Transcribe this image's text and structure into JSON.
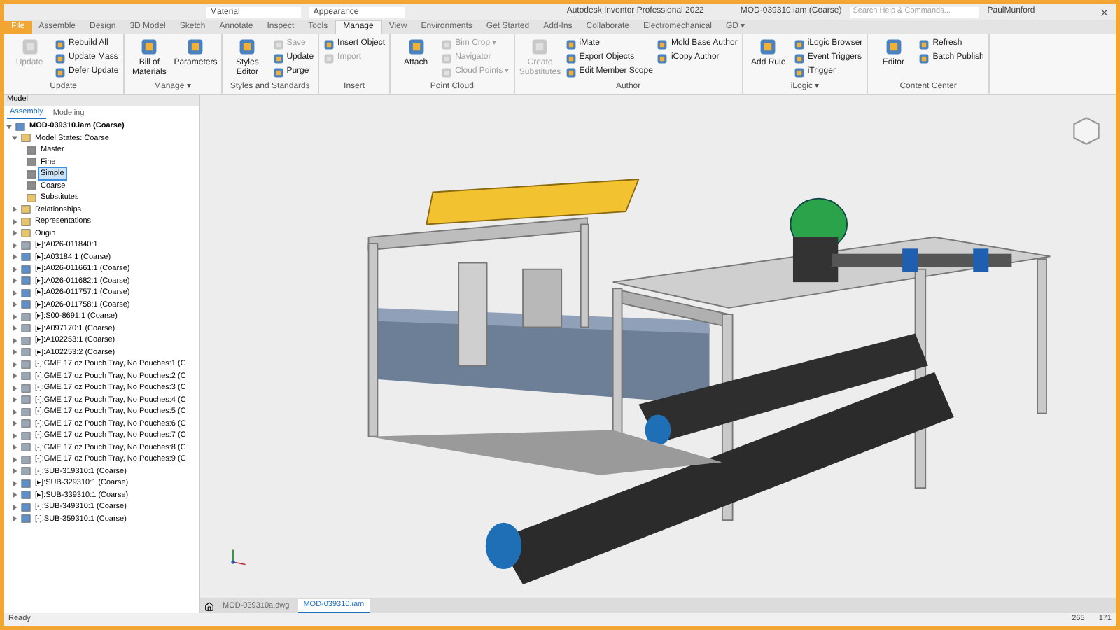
{
  "title_bar": {
    "app_title": "Autodesk Inventor Professional 2022",
    "document": "MOD-039310.iam (Coarse)",
    "material": "Material",
    "appearance": "Appearance",
    "search": {
      "placeholder": "Search Help & Commands..."
    },
    "user": "PaulMunford"
  },
  "ribbon_tabs": [
    {
      "label": "File",
      "selected": false,
      "kind": "file"
    },
    {
      "label": "Assemble",
      "selected": false
    },
    {
      "label": "Design",
      "selected": false
    },
    {
      "label": "3D Model",
      "selected": false
    },
    {
      "label": "Sketch",
      "selected": false
    },
    {
      "label": "Annotate",
      "selected": false
    },
    {
      "label": "Inspect",
      "selected": false
    },
    {
      "label": "Tools",
      "selected": false
    },
    {
      "label": "Manage",
      "selected": true
    },
    {
      "label": "View",
      "selected": false
    },
    {
      "label": "Environments",
      "selected": false
    },
    {
      "label": "Get Started",
      "selected": false
    },
    {
      "label": "Add-Ins",
      "selected": false
    },
    {
      "label": "Collaborate",
      "selected": false
    },
    {
      "label": "Electromechanical",
      "selected": false
    },
    {
      "label": "GD ▾",
      "selected": false
    }
  ],
  "ribbon_groups": [
    {
      "label": "Update",
      "items": [
        {
          "label": "Update",
          "kind": "big",
          "disabled": true
        },
        {
          "label": "Rebuild All",
          "kind": "small",
          "disabled": false
        },
        {
          "label": "Update Mass",
          "kind": "small",
          "disabled": false
        },
        {
          "label": "Defer Update",
          "kind": "small",
          "disabled": false
        }
      ]
    },
    {
      "label": "Manage ▾",
      "items": [
        {
          "label": "Bill of Materials",
          "kind": "big",
          "disabled": false
        },
        {
          "label": "Parameters",
          "kind": "big",
          "disabled": false
        }
      ]
    },
    {
      "label": "Styles and Standards",
      "items": [
        {
          "label": "Styles Editor",
          "kind": "big",
          "disabled": false
        },
        {
          "label": "Save",
          "kind": "small",
          "disabled": true
        },
        {
          "label": "Update",
          "kind": "small",
          "disabled": false
        },
        {
          "label": "Purge",
          "kind": "small",
          "disabled": false
        }
      ]
    },
    {
      "label": "Insert",
      "items": [
        {
          "label": "Insert Object",
          "kind": "small",
          "disabled": false
        },
        {
          "label": "Import",
          "kind": "small",
          "disabled": true
        }
      ]
    },
    {
      "label": "Point Cloud",
      "items": [
        {
          "label": "Attach",
          "kind": "big",
          "disabled": false
        },
        {
          "label": "Bim Crop ▾",
          "kind": "small",
          "disabled": true
        },
        {
          "label": "Navigator",
          "kind": "small",
          "disabled": true
        },
        {
          "label": "Cloud Points ▾",
          "kind": "small",
          "disabled": true
        }
      ]
    },
    {
      "label": "Author",
      "items": [
        {
          "label": "Create Substitutes",
          "kind": "big",
          "disabled": true
        },
        {
          "label": "iMate",
          "kind": "small",
          "disabled": false
        },
        {
          "label": "Export Objects",
          "kind": "small",
          "disabled": false
        },
        {
          "label": "Edit Member Scope",
          "kind": "small",
          "disabled": false
        },
        {
          "label": "Mold Base Author",
          "kind": "small",
          "disabled": false
        },
        {
          "label": "iCopy Author",
          "kind": "small",
          "disabled": false
        }
      ]
    },
    {
      "label": "iLogic ▾",
      "items": [
        {
          "label": "Add Rule",
          "kind": "big",
          "disabled": false
        },
        {
          "label": "iLogic Browser",
          "kind": "small",
          "disabled": false
        },
        {
          "label": "Event Triggers",
          "kind": "small",
          "disabled": false
        },
        {
          "label": "iTrigger",
          "kind": "small",
          "disabled": false
        }
      ]
    },
    {
      "label": "Content Center",
      "items": [
        {
          "label": "Editor",
          "kind": "big",
          "disabled": false
        },
        {
          "label": "Refresh",
          "kind": "small",
          "disabled": false
        },
        {
          "label": "Batch Publish",
          "kind": "small",
          "disabled": false
        }
      ]
    }
  ],
  "browser": {
    "panel_tab": "Model",
    "tabs": [
      {
        "label": "Assembly",
        "selected": true
      },
      {
        "label": "Modeling",
        "selected": false
      }
    ],
    "tree": [
      {
        "label": "MOD-039310.iam (Coarse)",
        "kind": "assembly",
        "selected": false,
        "expanded": true,
        "children": [
          {
            "label": "Model States: Coarse",
            "kind": "folder",
            "selected": false,
            "expanded": true,
            "children": [
              {
                "label": "Master",
                "kind": "state",
                "selected": false
              },
              {
                "label": "Fine",
                "kind": "state",
                "selected": false
              },
              {
                "label": "Simple",
                "kind": "state",
                "selected": true
              },
              {
                "label": "Coarse",
                "kind": "state",
                "selected": false
              },
              {
                "label": "Substitutes",
                "kind": "folder",
                "selected": false
              }
            ]
          },
          {
            "label": "Relationships",
            "kind": "folder",
            "selected": false,
            "expanded": false
          },
          {
            "label": "Representations",
            "kind": "folder",
            "selected": false,
            "expanded": false
          },
          {
            "label": "Origin",
            "kind": "folder",
            "selected": false,
            "expanded": false
          },
          {
            "label": "[▸]:A026-011840:1",
            "kind": "part",
            "selected": false,
            "expanded": false
          },
          {
            "label": "[▸]:A03184:1 (Coarse)",
            "kind": "assembly",
            "selected": false,
            "expanded": false
          },
          {
            "label": "[▸]:A026-011661:1 (Coarse)",
            "kind": "assembly",
            "selected": false,
            "expanded": false
          },
          {
            "label": "[▸]:A026-011682:1 (Coarse)",
            "kind": "assembly",
            "selected": false,
            "expanded": false
          },
          {
            "label": "[▸]:A026-011757:1 (Coarse)",
            "kind": "assembly",
            "selected": false,
            "expanded": false
          },
          {
            "label": "[▸]:A026-011758:1 (Coarse)",
            "kind": "assembly",
            "selected": false,
            "expanded": false
          },
          {
            "label": "[▸]:S00-8691:1 (Coarse)",
            "kind": "part",
            "selected": false,
            "expanded": false
          },
          {
            "label": "[▸]:A097170:1 (Coarse)",
            "kind": "part",
            "selected": false,
            "expanded": false
          },
          {
            "label": "[▸]:A102253:1 (Coarse)",
            "kind": "part",
            "selected": false,
            "expanded": false
          },
          {
            "label": "[▸]:A102253:2 (Coarse)",
            "kind": "part",
            "selected": false,
            "expanded": false
          },
          {
            "label": "[-]:GME 17 oz Pouch Tray, No Pouches:1 (C",
            "kind": "part",
            "selected": false,
            "expanded": false
          },
          {
            "label": "[-]:GME 17 oz Pouch Tray, No Pouches:2 (C",
            "kind": "part",
            "selected": false,
            "expanded": false
          },
          {
            "label": "[-]:GME 17 oz Pouch Tray, No Pouches:3 (C",
            "kind": "part",
            "selected": false,
            "expanded": false
          },
          {
            "label": "[-]:GME 17 oz Pouch Tray, No Pouches:4 (C",
            "kind": "part",
            "selected": false,
            "expanded": false
          },
          {
            "label": "[-]:GME 17 oz Pouch Tray, No Pouches:5 (C",
            "kind": "part",
            "selected": false,
            "expanded": false
          },
          {
            "label": "[-]:GME 17 oz Pouch Tray, No Pouches:6 (C",
            "kind": "part",
            "selected": false,
            "expanded": false
          },
          {
            "label": "[-]:GME 17 oz Pouch Tray, No Pouches:7 (C",
            "kind": "part",
            "selected": false,
            "expanded": false
          },
          {
            "label": "[-]:GME 17 oz Pouch Tray, No Pouches:8 (C",
            "kind": "part",
            "selected": false,
            "expanded": false
          },
          {
            "label": "[-]:GME 17 oz Pouch Tray, No Pouches:9 (C",
            "kind": "part",
            "selected": false,
            "expanded": false
          },
          {
            "label": "[-]:SUB-319310:1 (Coarse)",
            "kind": "part",
            "selected": false,
            "expanded": false
          },
          {
            "label": "[▸]:SUB-329310:1 (Coarse)",
            "kind": "assembly",
            "selected": false,
            "expanded": false
          },
          {
            "label": "[▸]:SUB-339310:1 (Coarse)",
            "kind": "assembly",
            "selected": false,
            "expanded": false
          },
          {
            "label": "[-]:SUB-349310:1 (Coarse)",
            "kind": "assembly",
            "selected": false,
            "expanded": false
          },
          {
            "label": "[-]:SUB-359310:1 (Coarse)",
            "kind": "assembly",
            "selected": false,
            "expanded": false
          }
        ]
      }
    ]
  },
  "document_tabs": [
    {
      "label": "MOD-039310a.dwg",
      "selected": false
    },
    {
      "label": "MOD-039310.iam",
      "selected": true
    }
  ],
  "status_bar": {
    "message": "Ready",
    "value_1": "265",
    "value_2": "171"
  }
}
